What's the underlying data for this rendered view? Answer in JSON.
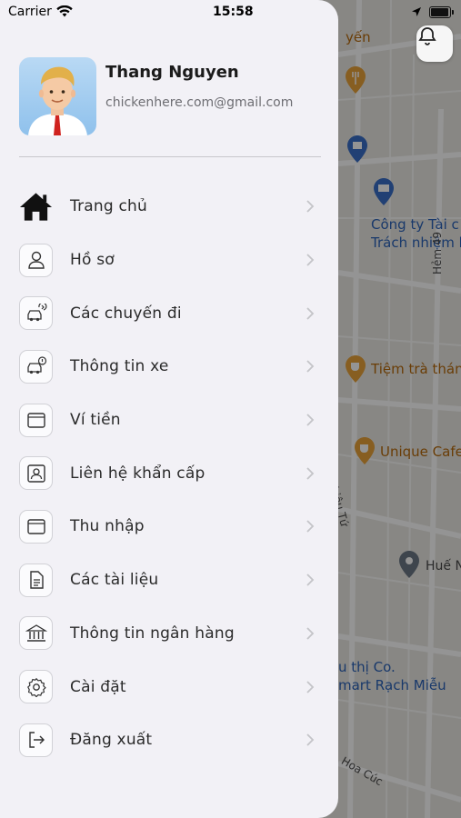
{
  "status_bar": {
    "carrier": "Carrier",
    "time": "15:58"
  },
  "profile": {
    "name": "Thang Nguyen",
    "email": "chickenhere.com@gmail.com"
  },
  "menu": [
    {
      "label": "Trang chủ",
      "icon": "home-icon"
    },
    {
      "label": "Hồ sơ",
      "icon": "user-icon"
    },
    {
      "label": "Các chuyến đi",
      "icon": "car-refresh-icon"
    },
    {
      "label": "Thông tin xe",
      "icon": "car-info-icon"
    },
    {
      "label": "Ví tiền",
      "icon": "wallet-icon"
    },
    {
      "label": "Liên hệ khẩn cấp",
      "icon": "contact-card-icon"
    },
    {
      "label": "Thu nhập",
      "icon": "wallet-icon"
    },
    {
      "label": "Các tài liệu",
      "icon": "document-icon"
    },
    {
      "label": "Thông tin ngân hàng",
      "icon": "bank-icon"
    },
    {
      "label": "Cài đặt",
      "icon": "gear-icon"
    },
    {
      "label": "Đăng xuất",
      "icon": "logout-icon"
    }
  ],
  "map": {
    "labels": [
      {
        "text": "yến",
        "style": "orange"
      },
      {
        "text": "Công ty Tài c",
        "style": "blue"
      },
      {
        "text": "Trách nhiệm h",
        "style": "blue"
      },
      {
        "text": "Hẻm 49",
        "style": "dark"
      },
      {
        "text": "Tiệm trà tháng",
        "style": "orange"
      },
      {
        "text": "Unique Cafe",
        "style": "orange"
      },
      {
        "text": "Nhiêu Tứ",
        "style": "dark"
      },
      {
        "text": "Huế N",
        "style": "dark"
      },
      {
        "text": "u thị Co.",
        "style": "blue"
      },
      {
        "text": "mart Rạch Miễu",
        "style": "blue"
      },
      {
        "text": "Hoa Cúc",
        "style": "dark"
      }
    ]
  },
  "colors": {
    "drawer_bg": "#f2f1f6",
    "map_overlay": "rgba(0,0,0,0.42)",
    "poi_orange": "#e8a33a",
    "poi_blue": "#3a6fc8"
  }
}
